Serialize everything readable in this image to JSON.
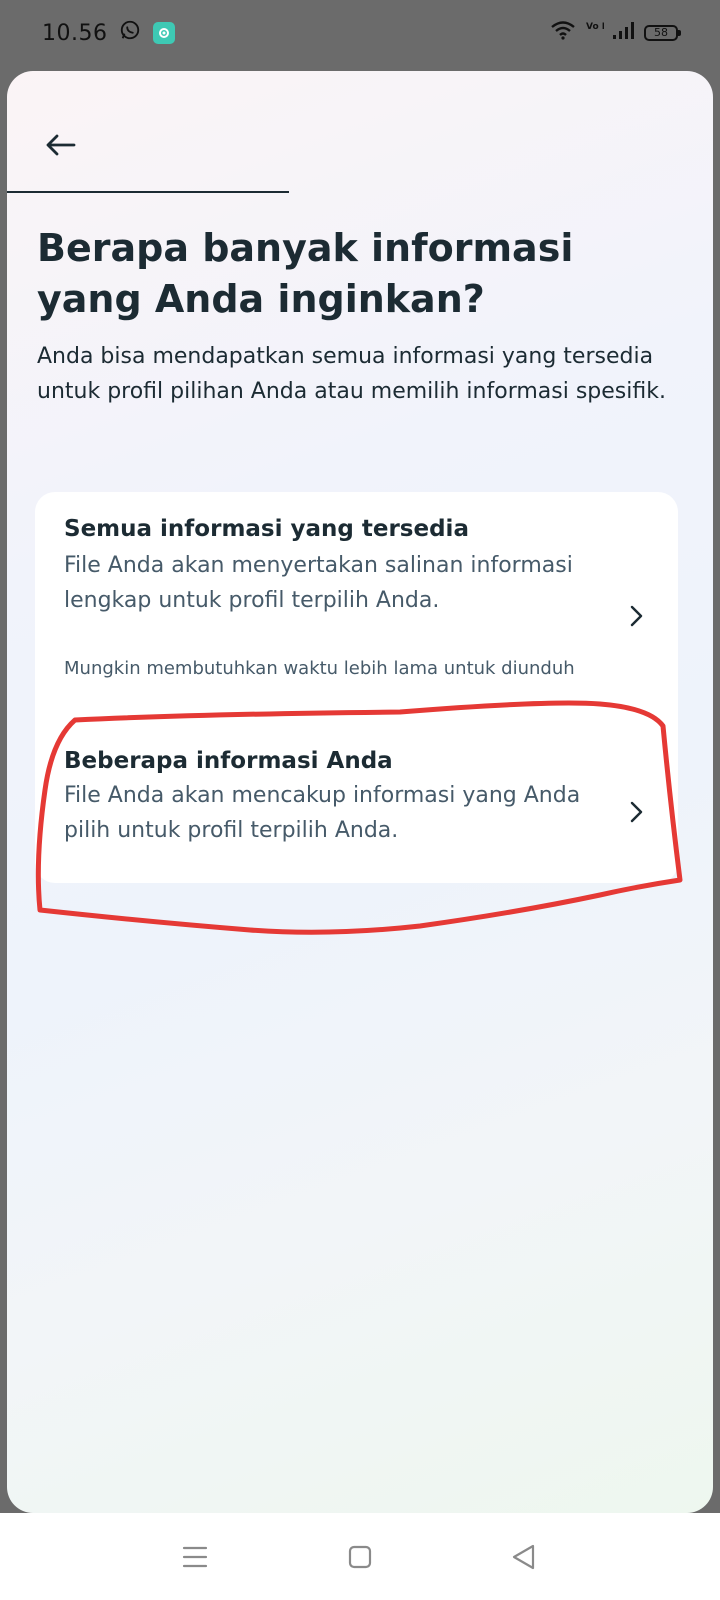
{
  "status_bar": {
    "time": "10.56",
    "battery": "58",
    "network_label": "Vo LTE",
    "icons": [
      "whatsapp-icon",
      "app-notification-icon",
      "wifi-icon",
      "volte-icon",
      "signal-icon",
      "battery-icon"
    ]
  },
  "header": {
    "back_icon": "arrow-left-icon",
    "progress": 0.4
  },
  "page": {
    "title": "Berapa banyak informasi yang Anda inginkan?",
    "subtitle": "Anda bisa mendapatkan semua informasi yang tersedia untuk profil pilihan Anda atau memilih informasi spesifik."
  },
  "options": [
    {
      "title": "Semua informasi yang tersedia",
      "description": "File Anda akan menyertakan salinan informasi lengkap untuk profil terpilih Anda.",
      "note": "Mungkin membutuhkan waktu lebih lama untuk diunduh"
    },
    {
      "title": "Beberapa informasi Anda",
      "description": "File Anda akan mencakup informasi yang Anda pilih untuk profil terpilih Anda."
    }
  ],
  "annotation": {
    "color": "#e53935",
    "target": "Beberapa informasi Anda"
  },
  "colors": {
    "text_primary": "#1c2b33",
    "text_secondary": "#465a69",
    "card_bg": "#ffffff"
  },
  "nav_bar": {
    "icons": [
      "menu-icon",
      "home-square-icon",
      "back-triangle-icon"
    ]
  }
}
